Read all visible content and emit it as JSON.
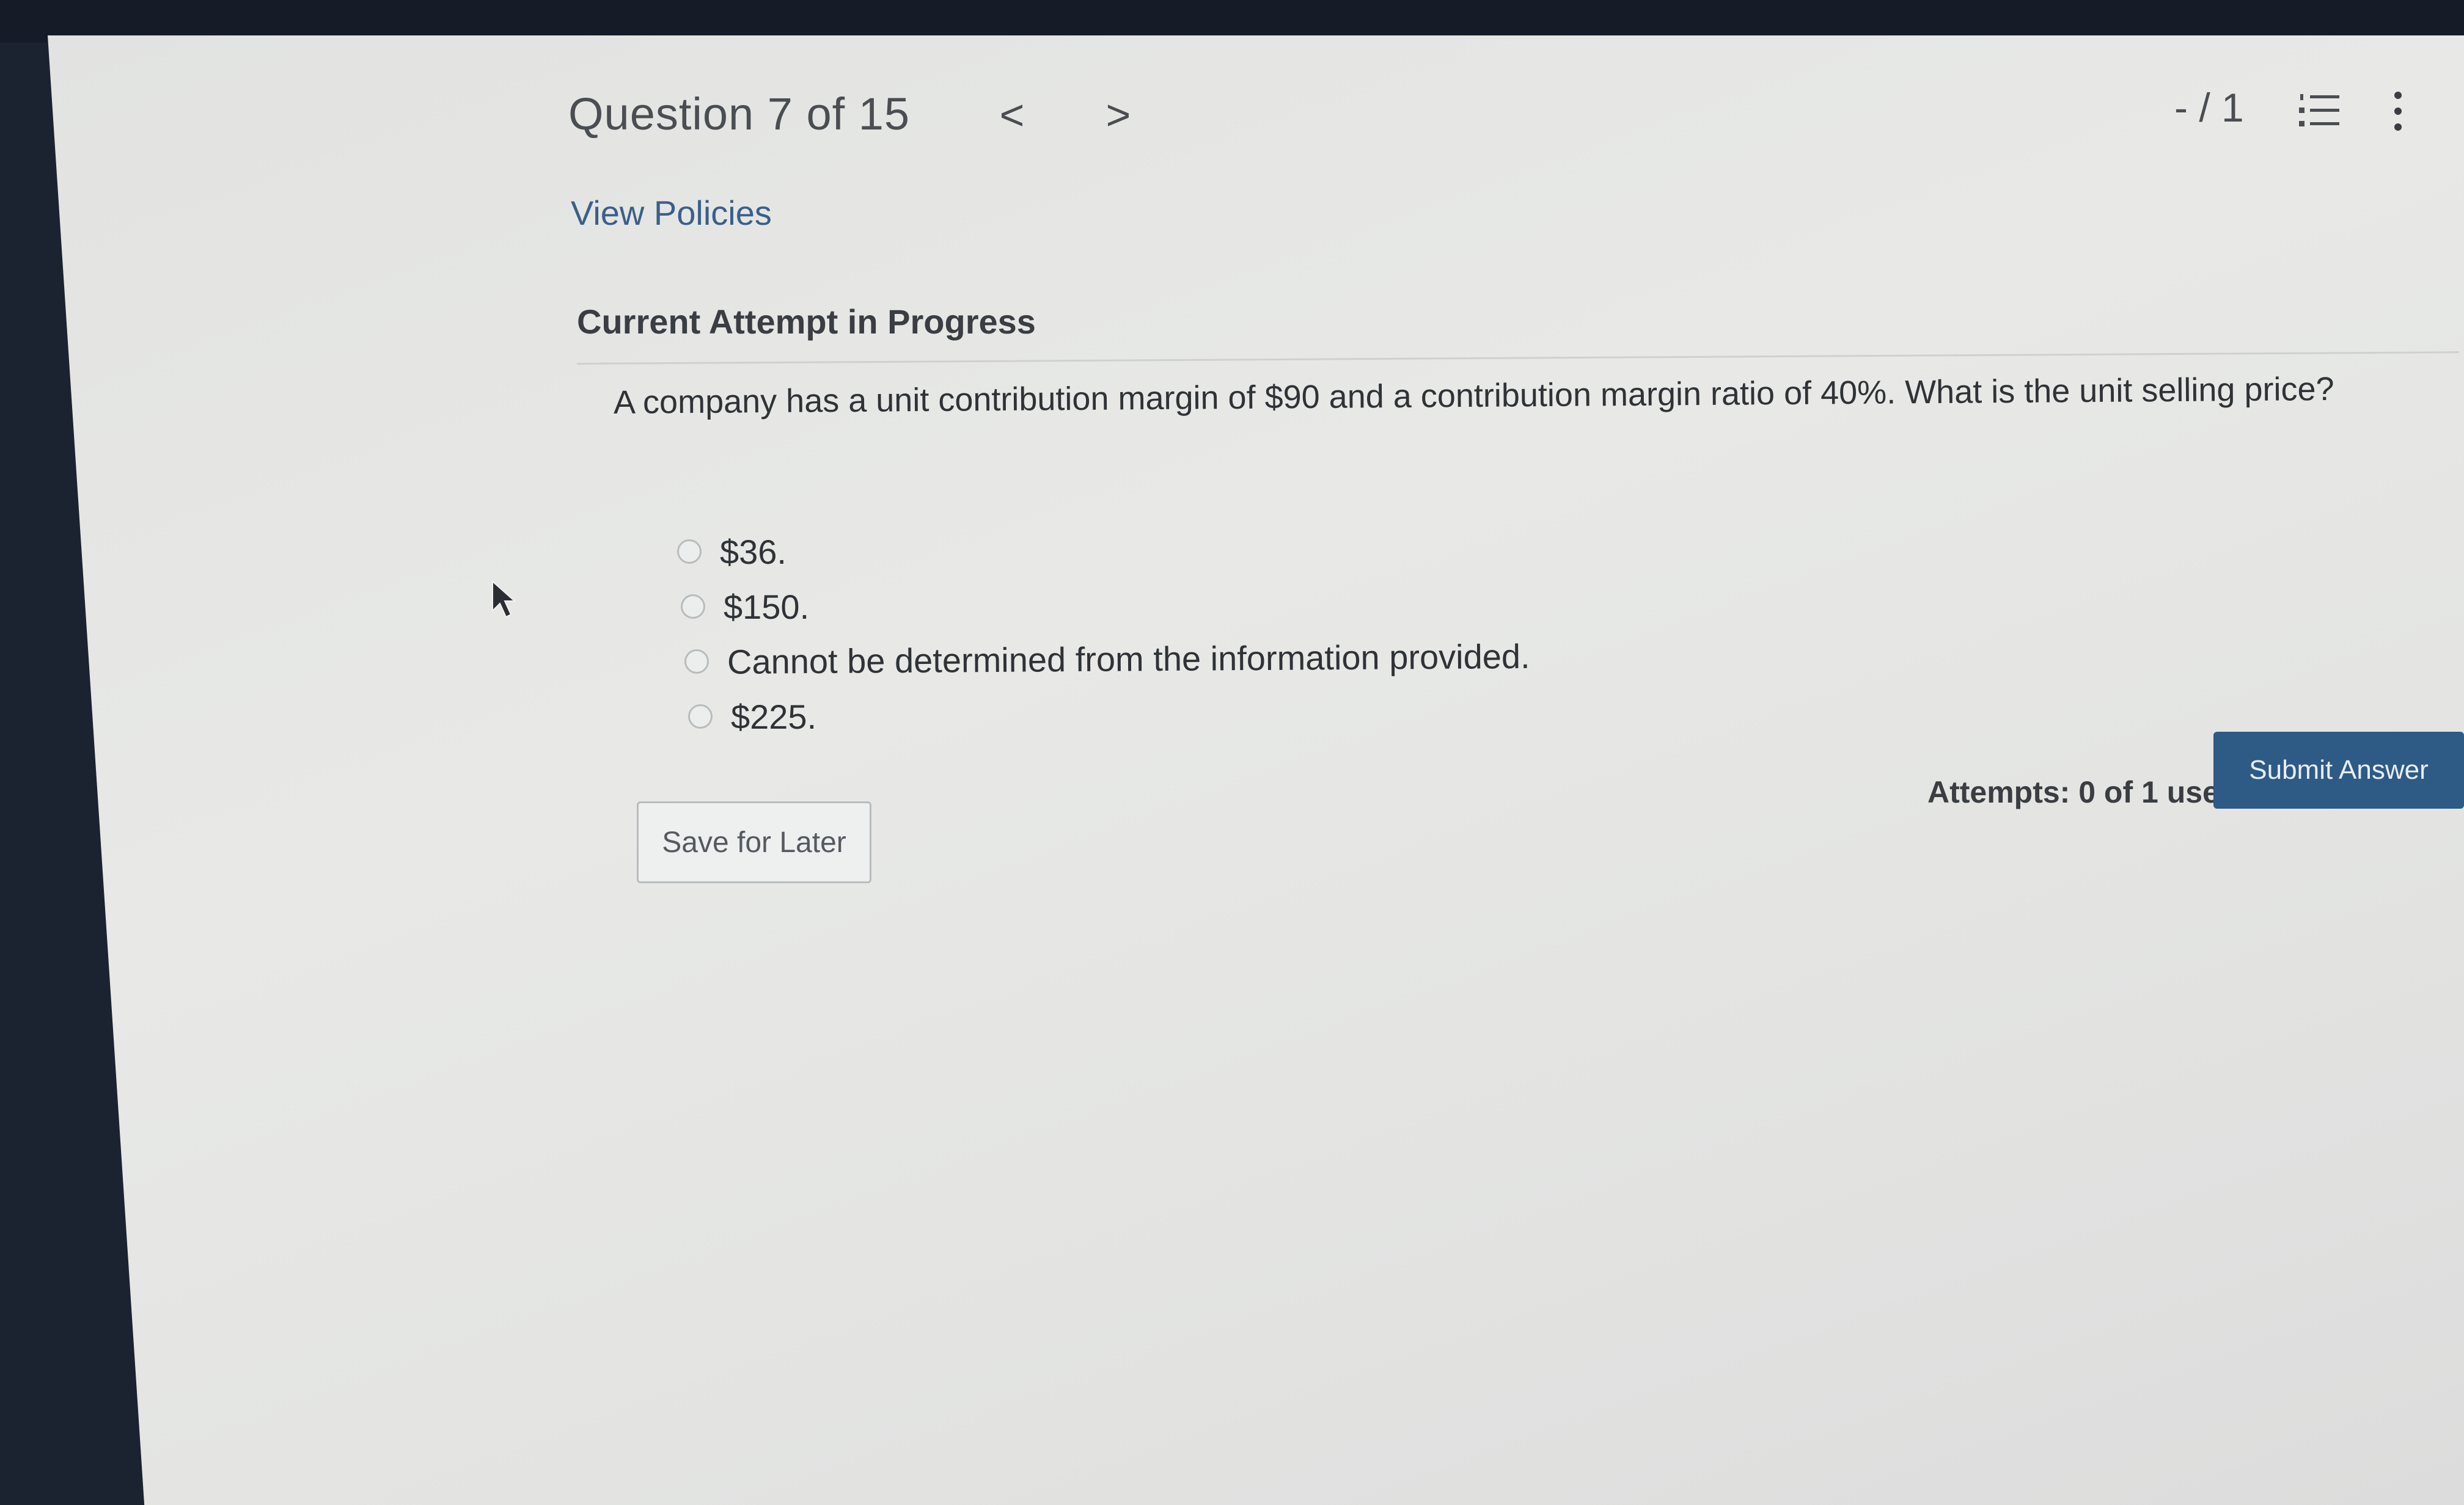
{
  "header": {
    "question_title": "Question 7 of 15",
    "prev_glyph": "<",
    "next_glyph": ">",
    "score": "- / 1",
    "list_icon": "list-numbered-icon",
    "more_icon": "more-vertical-icon"
  },
  "links": {
    "view_policies": "View Policies"
  },
  "attempt": {
    "section_title": "Current Attempt in Progress",
    "question_text": "A company has a unit contribution margin of $90 and a contribution margin ratio of 40%. What is the unit selling price?",
    "options": [
      {
        "label": "$36."
      },
      {
        "label": "$150."
      },
      {
        "label": "Cannot be determined from the information provided."
      },
      {
        "label": "$225."
      }
    ],
    "attempts_text": "Attempts: 0 of 1 used",
    "submit_label": "Submit Answer",
    "save_label": "Save for Later"
  },
  "colors": {
    "link": "#3a5f8a",
    "submit_bg": "#2e5a86",
    "text": "#2f3236"
  }
}
